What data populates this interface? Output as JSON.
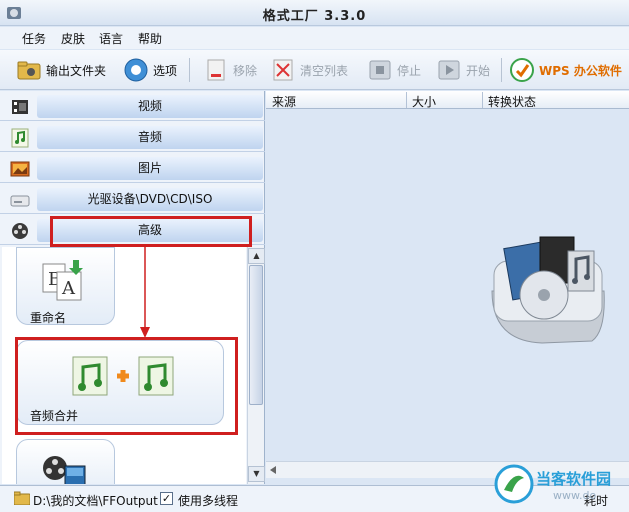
{
  "window": {
    "title": "格式工厂  3.3.0"
  },
  "menu": [
    "任务",
    "皮肤",
    "语言",
    "帮助"
  ],
  "toolbar": {
    "output_folder": "输出文件夹",
    "options": "选项",
    "remove": "移除",
    "clear_list": "清空列表",
    "stop": "停止",
    "start": "开始",
    "wps": "WPS 办公软件"
  },
  "categories": [
    "视频",
    "音频",
    "图片",
    "光驱设备\\DVD\\CD\\ISO",
    "高级"
  ],
  "tools": {
    "rename": "重命名",
    "audio_merge": "音频合并"
  },
  "filelist": {
    "columns": [
      "来源",
      "大小",
      "转换状态"
    ]
  },
  "status": {
    "output_path": "D:\\我的文档\\FFOutput",
    "multithread_label": "使用多线程",
    "multithread_checked": true,
    "time_label": "耗时"
  },
  "watermark": {
    "name": "当客软件园",
    "url": "www.do"
  },
  "colors": {
    "highlight": "#cf1f1f",
    "accent": "#2e74c9",
    "wps": "#e06d00",
    "watermark": "#2a9fd8"
  }
}
